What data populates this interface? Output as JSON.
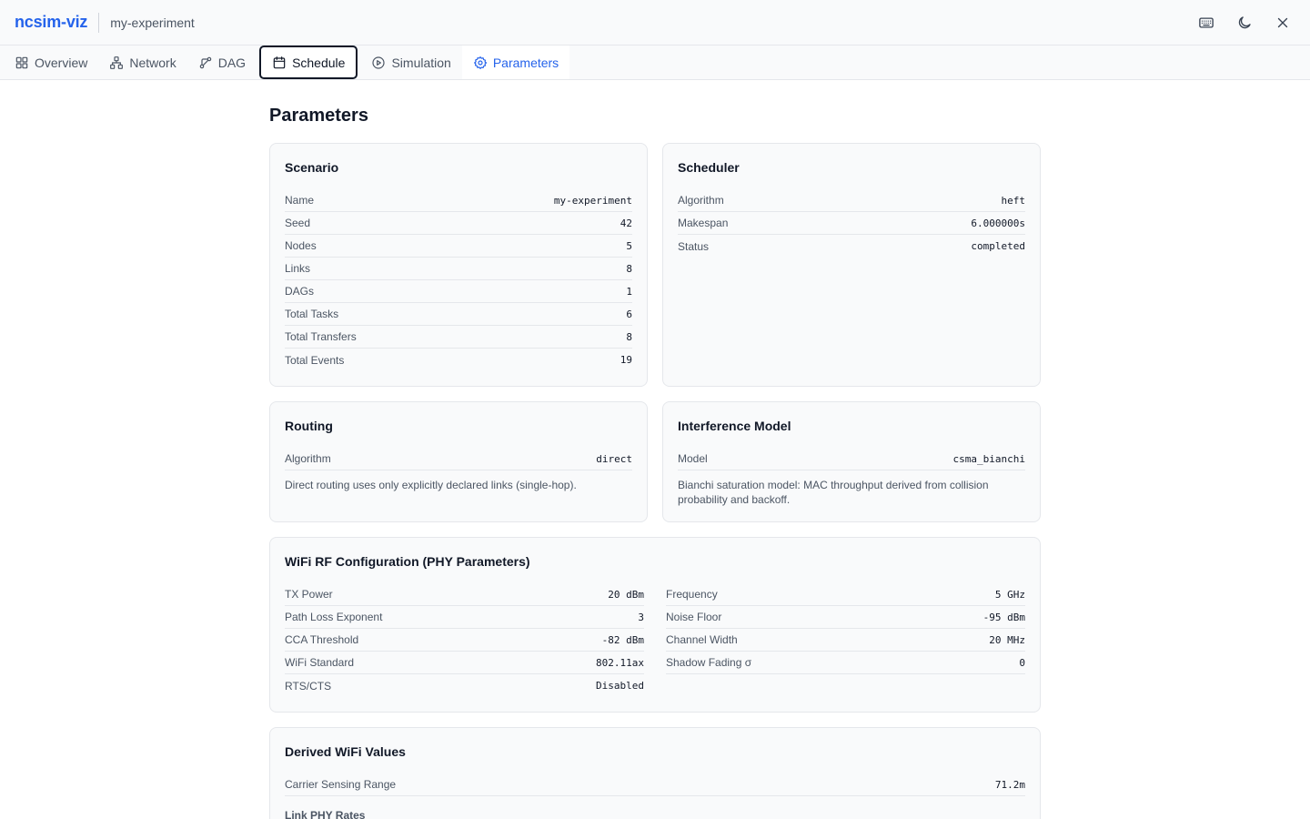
{
  "header": {
    "brand": "ncsim-viz",
    "experiment": "my-experiment"
  },
  "tabs": [
    {
      "label": "Overview",
      "icon": "grid-icon"
    },
    {
      "label": "Network",
      "icon": "network-icon"
    },
    {
      "label": "DAG",
      "icon": "dag-icon"
    },
    {
      "label": "Schedule",
      "icon": "calendar-icon"
    },
    {
      "label": "Simulation",
      "icon": "play-icon"
    },
    {
      "label": "Parameters",
      "icon": "gear-icon"
    }
  ],
  "page": {
    "title": "Parameters"
  },
  "scenario": {
    "title": "Scenario",
    "rows": [
      {
        "k": "Name",
        "v": "my-experiment"
      },
      {
        "k": "Seed",
        "v": "42"
      },
      {
        "k": "Nodes",
        "v": "5"
      },
      {
        "k": "Links",
        "v": "8"
      },
      {
        "k": "DAGs",
        "v": "1"
      },
      {
        "k": "Total Tasks",
        "v": "6"
      },
      {
        "k": "Total Transfers",
        "v": "8"
      },
      {
        "k": "Total Events",
        "v": "19"
      }
    ]
  },
  "scheduler": {
    "title": "Scheduler",
    "rows": [
      {
        "k": "Algorithm",
        "v": "heft"
      },
      {
        "k": "Makespan",
        "v": "6.000000s"
      },
      {
        "k": "Status",
        "v": "completed"
      }
    ]
  },
  "routing": {
    "title": "Routing",
    "rows": [
      {
        "k": "Algorithm",
        "v": "direct"
      }
    ],
    "description": "Direct routing uses only explicitly declared links (single-hop)."
  },
  "interference": {
    "title": "Interference Model",
    "rows": [
      {
        "k": "Model",
        "v": "csma_bianchi"
      }
    ],
    "description": "Bianchi saturation model: MAC throughput derived from collision probability and backoff."
  },
  "wifi": {
    "title": "WiFi RF Configuration (PHY Parameters)",
    "left": [
      {
        "k": "TX Power",
        "v": "20 dBm"
      },
      {
        "k": "Path Loss Exponent",
        "v": "3"
      },
      {
        "k": "CCA Threshold",
        "v": "-82 dBm"
      },
      {
        "k": "WiFi Standard",
        "v": "802.11ax"
      },
      {
        "k": "RTS/CTS",
        "v": "Disabled"
      }
    ],
    "right": [
      {
        "k": "Frequency",
        "v": "5 GHz"
      },
      {
        "k": "Noise Floor",
        "v": "-95 dBm"
      },
      {
        "k": "Channel Width",
        "v": "20 MHz"
      },
      {
        "k": "Shadow Fading σ",
        "v": "0"
      }
    ]
  },
  "derived": {
    "title": "Derived WiFi Values",
    "rows": [
      {
        "k": "Carrier Sensing Range",
        "v": "71.2m"
      }
    ],
    "sub_heading": "Link PHY Rates"
  }
}
